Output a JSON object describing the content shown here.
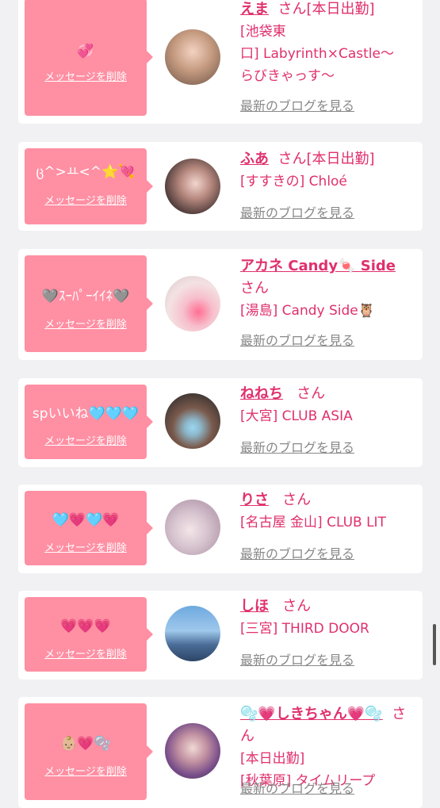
{
  "delete_label": "メッセージを削除",
  "blog_label": "最新のブログを見る",
  "san": "さん",
  "entries": [
    {
      "message": "💞",
      "name": "えま",
      "status": "[本日出勤]",
      "shop_lines": [
        "[池袋東",
        "口] Labyrinth×Castle〜",
        "らびきゃっす〜"
      ]
    },
    {
      "message": "ც^>ㅛ<^⭐💘",
      "name": "ふあ",
      "status": "[本日出勤]",
      "shop_lines": [
        "[すすきの] Chloé"
      ]
    },
    {
      "message": "🩶ｽｰﾊﾟｰｲｲﾈ🩶",
      "name": "アカネ Candy🍬 Side",
      "status": "",
      "shop_lines": [
        "[湯島] Candy Side🦉"
      ]
    },
    {
      "message": "spいいね🩵🩵🩵",
      "name": "ねねち",
      "status": "",
      "shop_lines": [
        "[大宮] CLUB ASIA"
      ]
    },
    {
      "message": "🩵💗🩵💗",
      "name": "りさ",
      "status": "",
      "shop_lines": [
        "[名古屋 金山] CLUB LIT"
      ]
    },
    {
      "message": "💗💗💗",
      "name": "しほ",
      "status": "",
      "shop_lines": [
        "[三宮] THIRD DOOR"
      ]
    },
    {
      "message": "👶🏼💗🫧",
      "name": "🫧💗しきちゃん💗🫧",
      "status": "[本日出勤]",
      "shop_lines": [
        "[秋葉原] タイムリープ"
      ]
    }
  ],
  "colors": {
    "accent": "#e0306d",
    "bubble": "#ff8fa3",
    "background": "#f1f1f3"
  }
}
